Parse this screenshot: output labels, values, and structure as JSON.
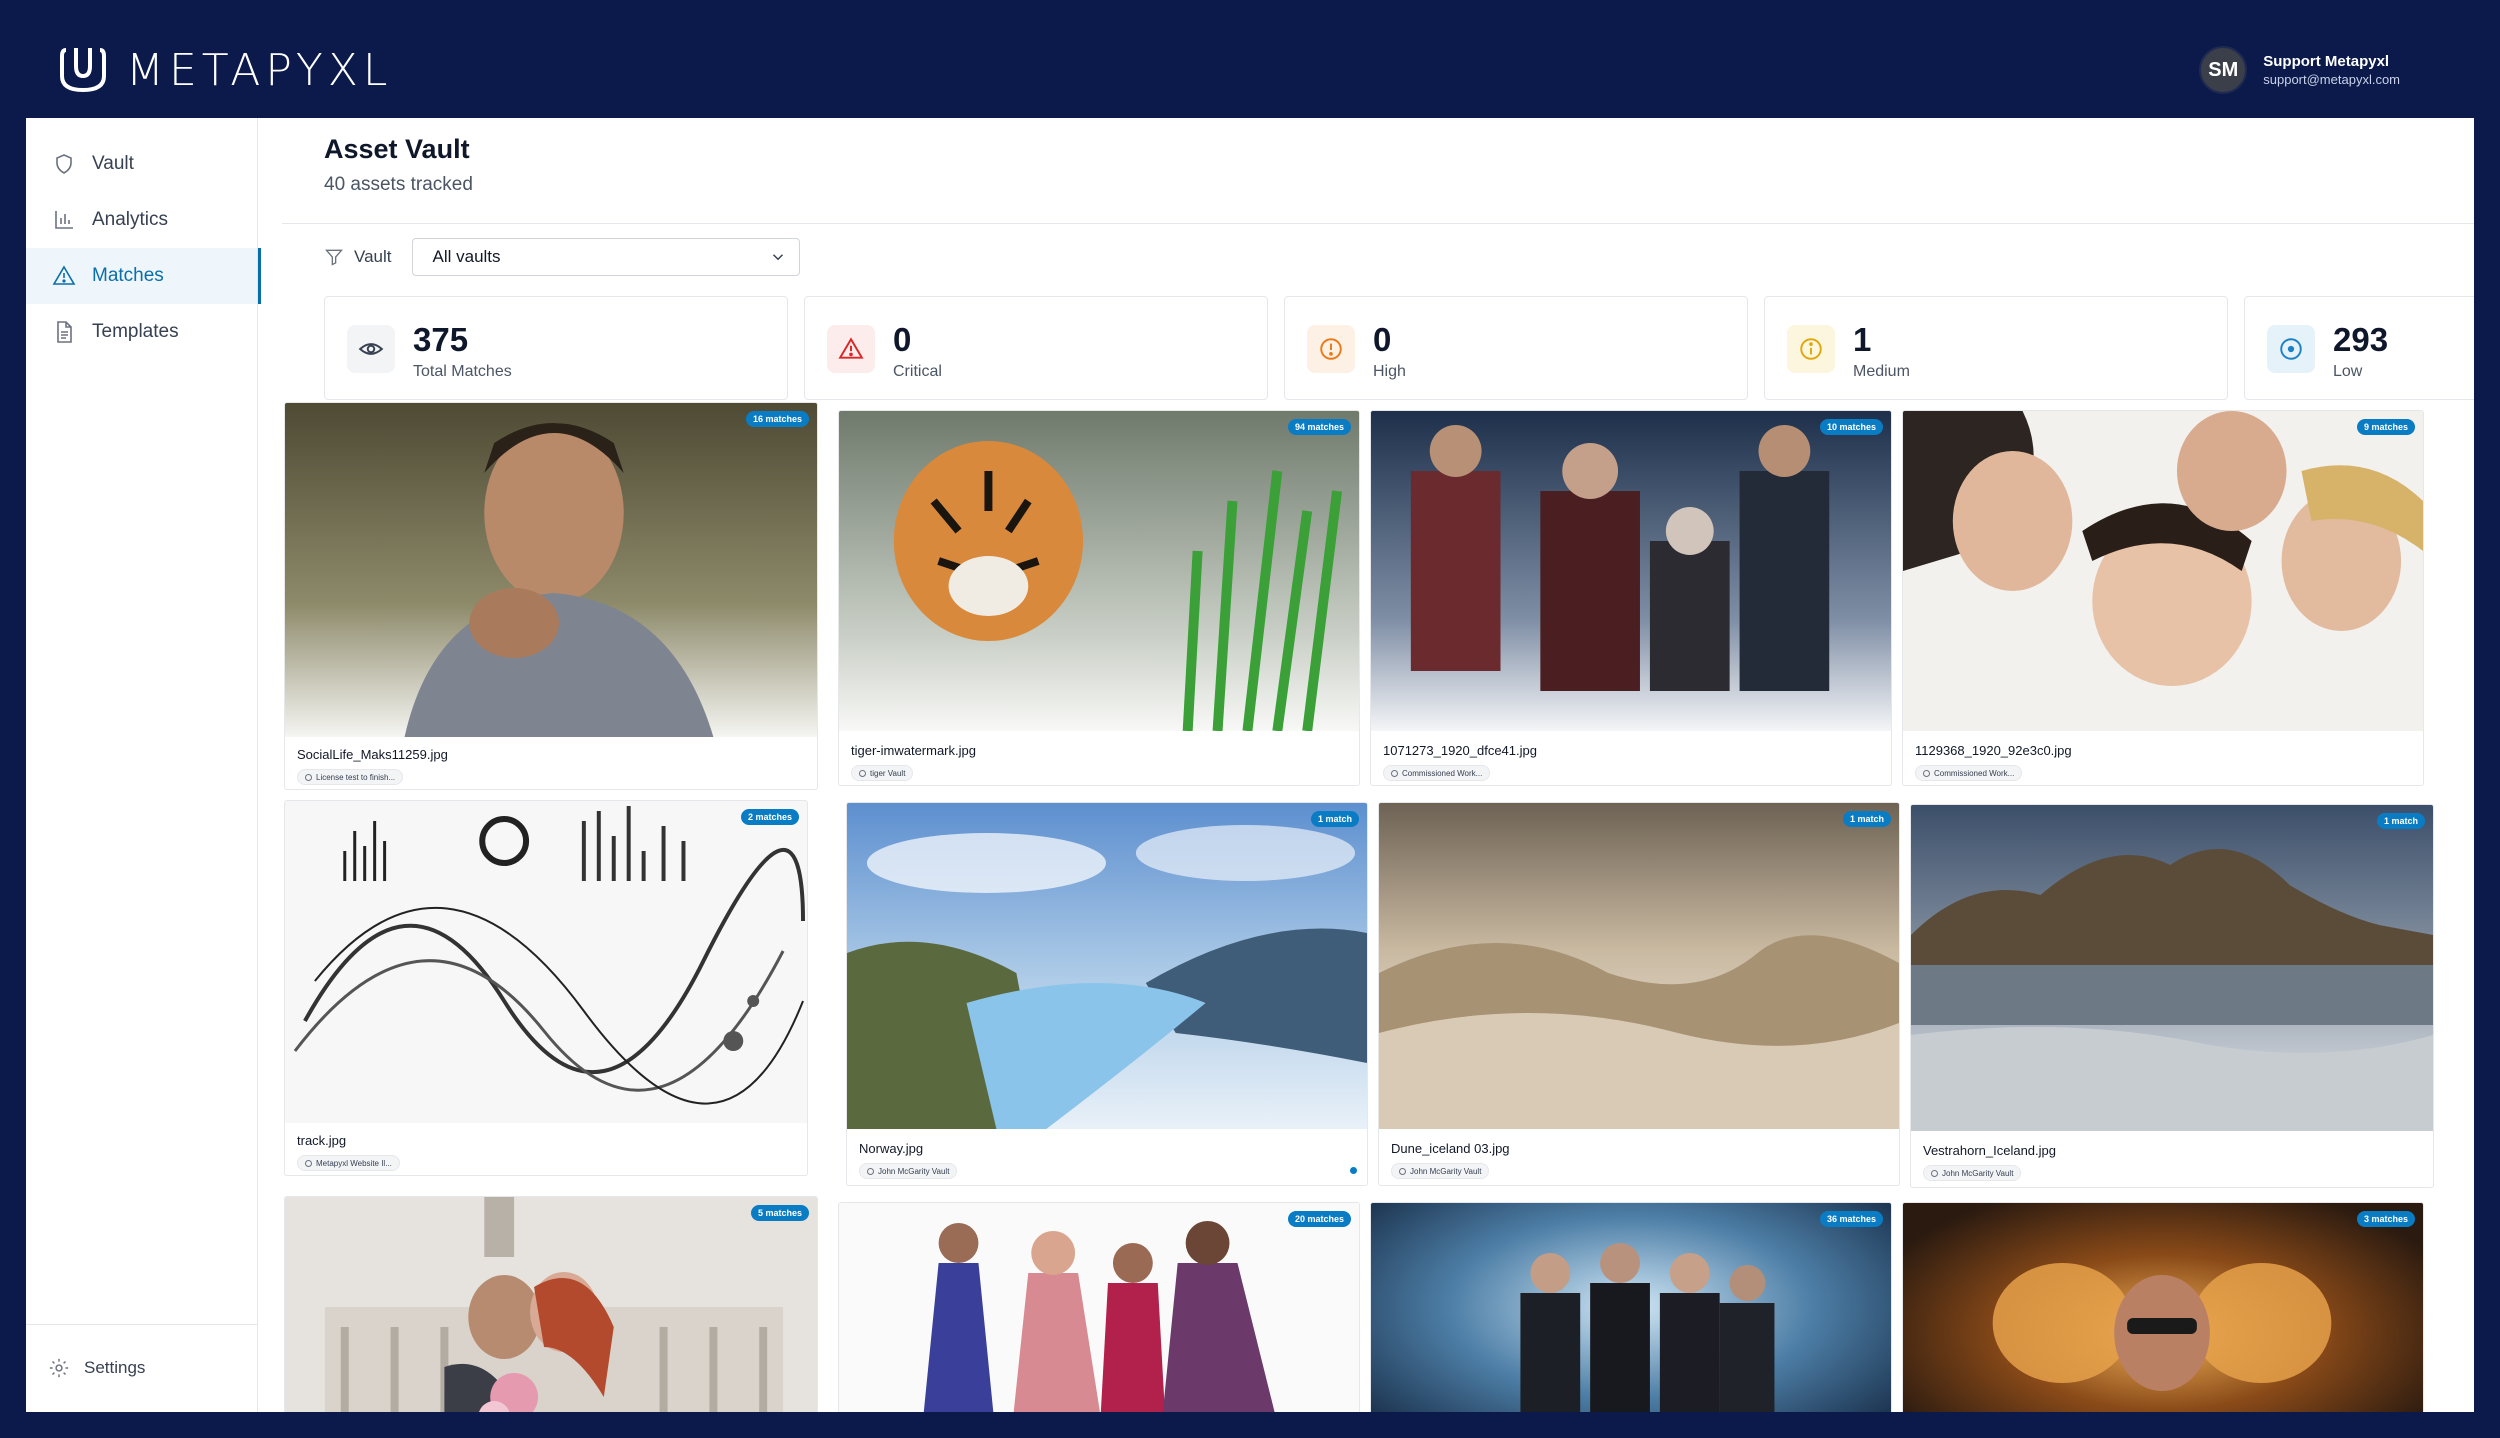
{
  "brand": {
    "name": "METAPYXL"
  },
  "user": {
    "initials": "SM",
    "name": "Support Metapyxl",
    "email": "support@metapyxl.com"
  },
  "sidebar": {
    "items": [
      {
        "label": "Vault",
        "icon": "shield-icon"
      },
      {
        "label": "Analytics",
        "icon": "bar-chart-icon"
      },
      {
        "label": "Matches",
        "icon": "warning-triangle-icon",
        "active": true
      },
      {
        "label": "Templates",
        "icon": "document-icon"
      }
    ],
    "settings_label": "Settings"
  },
  "page": {
    "title": "Asset Vault",
    "subtitle": "40 assets tracked"
  },
  "filter": {
    "label": "Vault",
    "selected": "All vaults"
  },
  "stats": [
    {
      "value": "375",
      "label": "Total Matches",
      "icon": "eye-icon",
      "color": "#374151",
      "bg": "#f3f4f6"
    },
    {
      "value": "0",
      "label": "Critical",
      "icon": "alert-triangle-icon",
      "color": "#dc2626",
      "bg": "#fdecec"
    },
    {
      "value": "0",
      "label": "High",
      "icon": "alert-circle-icon",
      "color": "#ea7a1a",
      "bg": "#fdf0e4"
    },
    {
      "value": "1",
      "label": "Medium",
      "icon": "info-circle-icon",
      "color": "#e0a80f",
      "bg": "#fdf6df"
    },
    {
      "value": "293",
      "label": "Low",
      "icon": "target-circle-icon",
      "color": "#1d82c4",
      "bg": "#e6f2fa"
    }
  ],
  "assets": [
    {
      "name": "SocialLife_Maks11259.jpg",
      "vault": "License test to finish...",
      "matches": "16 matches",
      "art": "portrait-man"
    },
    {
      "name": "tiger-imwatermark.jpg",
      "vault": "tiger Vault",
      "matches": "94 matches",
      "art": "tiger"
    },
    {
      "name": "1071273_1920_dfce41.jpg",
      "vault": "Commissioned Work...",
      "matches": "10 matches",
      "art": "group-dark"
    },
    {
      "name": "1129368_1920_92e3c0.jpg",
      "vault": "Commissioned Work...",
      "matches": "9 matches",
      "art": "friends-circle"
    },
    {
      "name": "track.jpg",
      "vault": "Metapyxl Website Il...",
      "matches": "2 matches",
      "art": "sketch"
    },
    {
      "name": "Norway.jpg",
      "vault": "John McGarity Vault",
      "matches": "1 match",
      "art": "fjord"
    },
    {
      "name": "Dune_iceland 03.jpg",
      "vault": "John McGarity Vault",
      "matches": "1 match",
      "art": "dunes"
    },
    {
      "name": "Vestrahorn_Iceland.jpg",
      "vault": "John McGarity Vault",
      "matches": "1 match",
      "art": "mountain"
    },
    {
      "name": "",
      "vault": "",
      "matches": "5 matches",
      "art": "wedding"
    },
    {
      "name": "",
      "vault": "",
      "matches": "20 matches",
      "art": "performers"
    },
    {
      "name": "",
      "vault": "",
      "matches": "36 matches",
      "art": "band"
    },
    {
      "name": "",
      "vault": "",
      "matches": "3 matches",
      "art": "fire-portrait"
    }
  ]
}
